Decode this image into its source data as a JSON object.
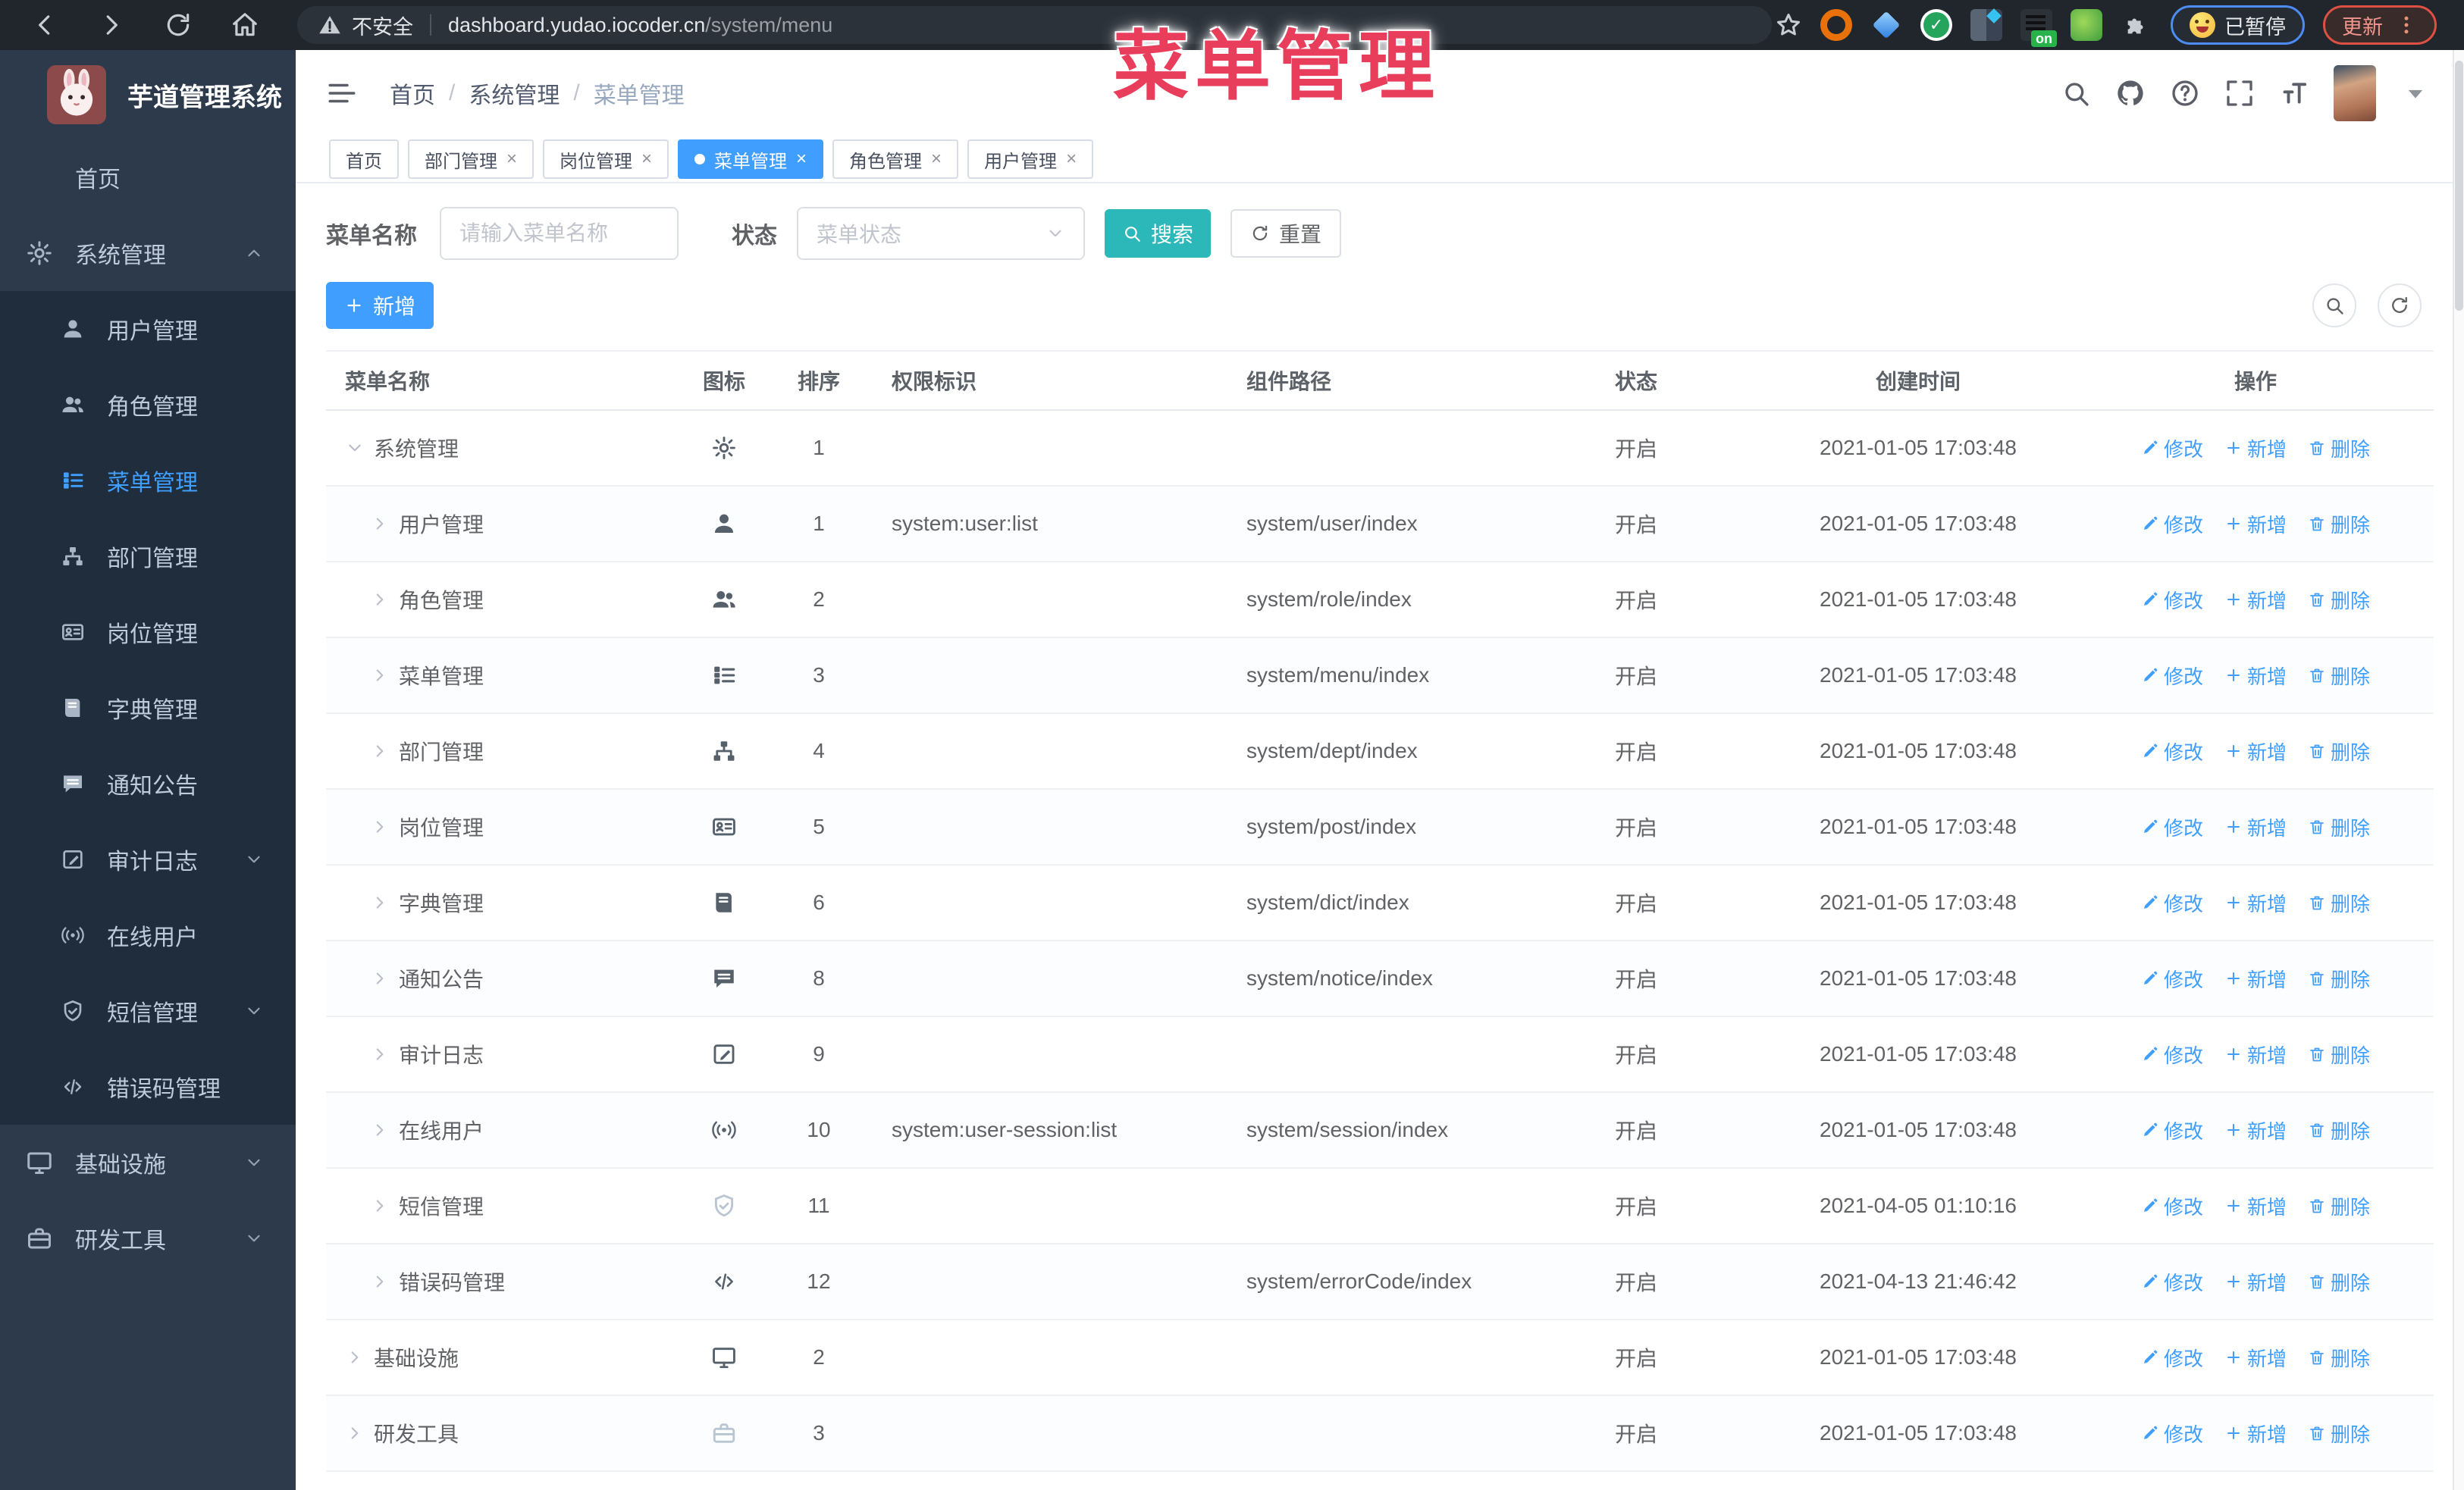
{
  "browser": {
    "security_label": "不安全",
    "url_host": "dashboard.yudao.iocoder.cn",
    "url_path": "/system/menu",
    "on_badge": "on",
    "paused_label": "已暂停",
    "update_label": "更新"
  },
  "overlay": {
    "title": "菜单管理",
    "color": "#e83e5c"
  },
  "sidebar": {
    "app_title": "芋道管理系统",
    "items": [
      {
        "label": "首页",
        "icon": "gauge",
        "type": "item"
      },
      {
        "label": "系统管理",
        "icon": "gear",
        "type": "item",
        "chevron": "up"
      },
      {
        "label": "用户管理",
        "icon": "user",
        "type": "sub"
      },
      {
        "label": "角色管理",
        "icon": "users",
        "type": "sub"
      },
      {
        "label": "菜单管理",
        "icon": "list",
        "type": "sub",
        "active": true
      },
      {
        "label": "部门管理",
        "icon": "tree",
        "type": "sub"
      },
      {
        "label": "岗位管理",
        "icon": "badge",
        "type": "sub"
      },
      {
        "label": "字典管理",
        "icon": "book",
        "type": "sub"
      },
      {
        "label": "通知公告",
        "icon": "message",
        "type": "sub"
      },
      {
        "label": "审计日志",
        "icon": "edit",
        "type": "sub",
        "chevron": "down"
      },
      {
        "label": "在线用户",
        "icon": "online",
        "type": "sub"
      },
      {
        "label": "短信管理",
        "icon": "shield",
        "type": "sub",
        "chevron": "down"
      },
      {
        "label": "错误码管理",
        "icon": "code",
        "type": "sub"
      },
      {
        "label": "基础设施",
        "icon": "monitor",
        "type": "item",
        "chevron": "down"
      },
      {
        "label": "研发工具",
        "icon": "tools",
        "type": "item",
        "chevron": "down"
      }
    ]
  },
  "header": {
    "breadcrumb": [
      "首页",
      "系统管理",
      "菜单管理"
    ]
  },
  "tabs": [
    {
      "label": "首页",
      "closable": false,
      "active": false
    },
    {
      "label": "部门管理",
      "closable": true,
      "active": false
    },
    {
      "label": "岗位管理",
      "closable": true,
      "active": false
    },
    {
      "label": "菜单管理",
      "closable": true,
      "active": true
    },
    {
      "label": "角色管理",
      "closable": true,
      "active": false
    },
    {
      "label": "用户管理",
      "closable": true,
      "active": false
    }
  ],
  "filters": {
    "name_label": "菜单名称",
    "name_placeholder": "请输入菜单名称",
    "status_label": "状态",
    "status_placeholder": "菜单状态",
    "search_label": "搜索",
    "reset_label": "重置"
  },
  "toolbar": {
    "add_label": "新增"
  },
  "table": {
    "columns": [
      "菜单名称",
      "图标",
      "排序",
      "权限标识",
      "组件路径",
      "状态",
      "创建时间",
      "操作"
    ],
    "actions": {
      "edit": "修改",
      "add": "新增",
      "delete": "删除"
    },
    "rows": [
      {
        "name": "系统管理",
        "level": 1,
        "expanded": true,
        "icon": "gear",
        "order": 1,
        "perm": "",
        "path": "",
        "status": "开启",
        "time": "2021-01-05 17:03:48"
      },
      {
        "name": "用户管理",
        "level": 2,
        "expanded": false,
        "icon": "user",
        "order": 1,
        "perm": "system:user:list",
        "path": "system/user/index",
        "status": "开启",
        "time": "2021-01-05 17:03:48"
      },
      {
        "name": "角色管理",
        "level": 2,
        "expanded": false,
        "icon": "users",
        "order": 2,
        "perm": "",
        "path": "system/role/index",
        "status": "开启",
        "time": "2021-01-05 17:03:48"
      },
      {
        "name": "菜单管理",
        "level": 2,
        "expanded": false,
        "icon": "list",
        "order": 3,
        "perm": "",
        "path": "system/menu/index",
        "status": "开启",
        "time": "2021-01-05 17:03:48"
      },
      {
        "name": "部门管理",
        "level": 2,
        "expanded": false,
        "icon": "tree",
        "order": 4,
        "perm": "",
        "path": "system/dept/index",
        "status": "开启",
        "time": "2021-01-05 17:03:48"
      },
      {
        "name": "岗位管理",
        "level": 2,
        "expanded": false,
        "icon": "badge",
        "order": 5,
        "perm": "",
        "path": "system/post/index",
        "status": "开启",
        "time": "2021-01-05 17:03:48"
      },
      {
        "name": "字典管理",
        "level": 2,
        "expanded": false,
        "icon": "book",
        "order": 6,
        "perm": "",
        "path": "system/dict/index",
        "status": "开启",
        "time": "2021-01-05 17:03:48"
      },
      {
        "name": "通知公告",
        "level": 2,
        "expanded": false,
        "icon": "message",
        "order": 8,
        "perm": "",
        "path": "system/notice/index",
        "status": "开启",
        "time": "2021-01-05 17:03:48"
      },
      {
        "name": "审计日志",
        "level": 2,
        "expanded": false,
        "icon": "edit",
        "order": 9,
        "perm": "",
        "path": "",
        "status": "开启",
        "time": "2021-01-05 17:03:48"
      },
      {
        "name": "在线用户",
        "level": 2,
        "expanded": false,
        "icon": "online",
        "order": 10,
        "perm": "system:user-session:list",
        "path": "system/session/index",
        "status": "开启",
        "time": "2021-01-05 17:03:48"
      },
      {
        "name": "短信管理",
        "level": 2,
        "expanded": false,
        "icon": "shield",
        "order": 11,
        "perm": "",
        "path": "",
        "status": "开启",
        "time": "2021-04-05 01:10:16",
        "icon_muted": true
      },
      {
        "name": "错误码管理",
        "level": 2,
        "expanded": false,
        "icon": "code",
        "order": 12,
        "perm": "",
        "path": "system/errorCode/index",
        "status": "开启",
        "time": "2021-04-13 21:46:42"
      },
      {
        "name": "基础设施",
        "level": 1,
        "expanded": false,
        "icon": "monitor",
        "order": 2,
        "perm": "",
        "path": "",
        "status": "开启",
        "time": "2021-01-05 17:03:48"
      },
      {
        "name": "研发工具",
        "level": 1,
        "expanded": false,
        "icon": "tools",
        "order": 3,
        "perm": "",
        "path": "",
        "status": "开启",
        "time": "2021-01-05 17:03:48",
        "icon_muted": true
      }
    ]
  }
}
